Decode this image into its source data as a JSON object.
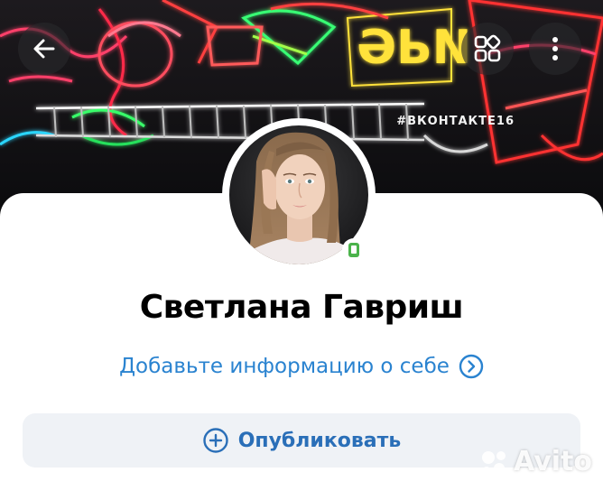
{
  "cover": {
    "hashtag": "#ВКОНТАКТЕ16",
    "neon_sign_text": "ƏЬN"
  },
  "profile": {
    "name": "Светлана Гавриш",
    "add_info_label": "Добавьте информацию о себе",
    "online_status": "mobile"
  },
  "actions": {
    "publish_label": "Опубликовать"
  },
  "icons": {
    "back": "arrow-left-icon",
    "qr": "qr-code-icon",
    "more": "more-vertical-icon",
    "chevron": "chevron-right-circle-icon",
    "plus": "plus-circle-icon"
  },
  "watermark": {
    "text": "Avito"
  },
  "colors": {
    "link_blue": "#2a83d0",
    "button_bg": "#eff2f6",
    "online_green": "#4bb34b"
  }
}
